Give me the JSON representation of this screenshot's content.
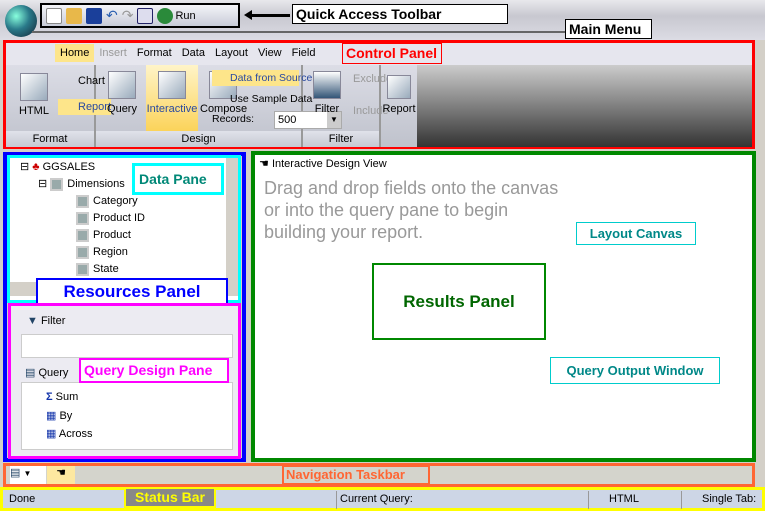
{
  "annotations": {
    "quick_access_toolbar": "Quick Access Toolbar",
    "main_menu": "Main Menu",
    "control_panel": "Control Panel",
    "data_pane": "Data Pane",
    "resources_panel": "Resources Panel",
    "query_design_pane": "Query Design Pane",
    "layout_canvas": "Layout Canvas",
    "results_panel": "Results Panel",
    "query_output_window": "Query Output Window",
    "navigation_taskbar": "Navigation Taskbar",
    "status_bar": "Status Bar"
  },
  "qat": {
    "run_label": "Run"
  },
  "menu_tabs": [
    "Home",
    "Insert",
    "Format",
    "Data",
    "Layout",
    "View",
    "Field"
  ],
  "ribbon": {
    "format": {
      "label": "Format",
      "html": "HTML",
      "chart": "Chart",
      "report": "Report"
    },
    "design": {
      "label": "Design",
      "query": "Query",
      "interactive": "Interactive",
      "compose": "Compose",
      "data_from_source": "Data from Source",
      "use_sample_data": "Use Sample Data",
      "records_label": "Records:",
      "records_value": "500"
    },
    "filter": {
      "label": "Filter",
      "filter": "Filter",
      "exclude": "Exclude",
      "include": "Include"
    },
    "report": {
      "label": "Report"
    }
  },
  "tree": {
    "root": "GGSALES",
    "dimensions": "Dimensions",
    "items": [
      "Category",
      "Product ID",
      "Product",
      "Region",
      "State"
    ]
  },
  "query_pane": {
    "filter": "Filter",
    "query": "Query",
    "items": [
      "Sum",
      "By",
      "Across"
    ]
  },
  "results": {
    "view_title": "Interactive Design View",
    "hint": "Drag and drop fields onto the canvas or into the query pane to begin building your report."
  },
  "status": {
    "done": "Done",
    "current_query": "Current Query:",
    "format": "HTML",
    "tab": "Single Tab:"
  },
  "colors": {
    "control_panel": "#ff0000",
    "resources": "#0000ff",
    "data_pane": "#00ffff",
    "query_pane": "#ff00ff",
    "results": "#008000",
    "nav": "#ff6633",
    "status": "#ffff00"
  }
}
